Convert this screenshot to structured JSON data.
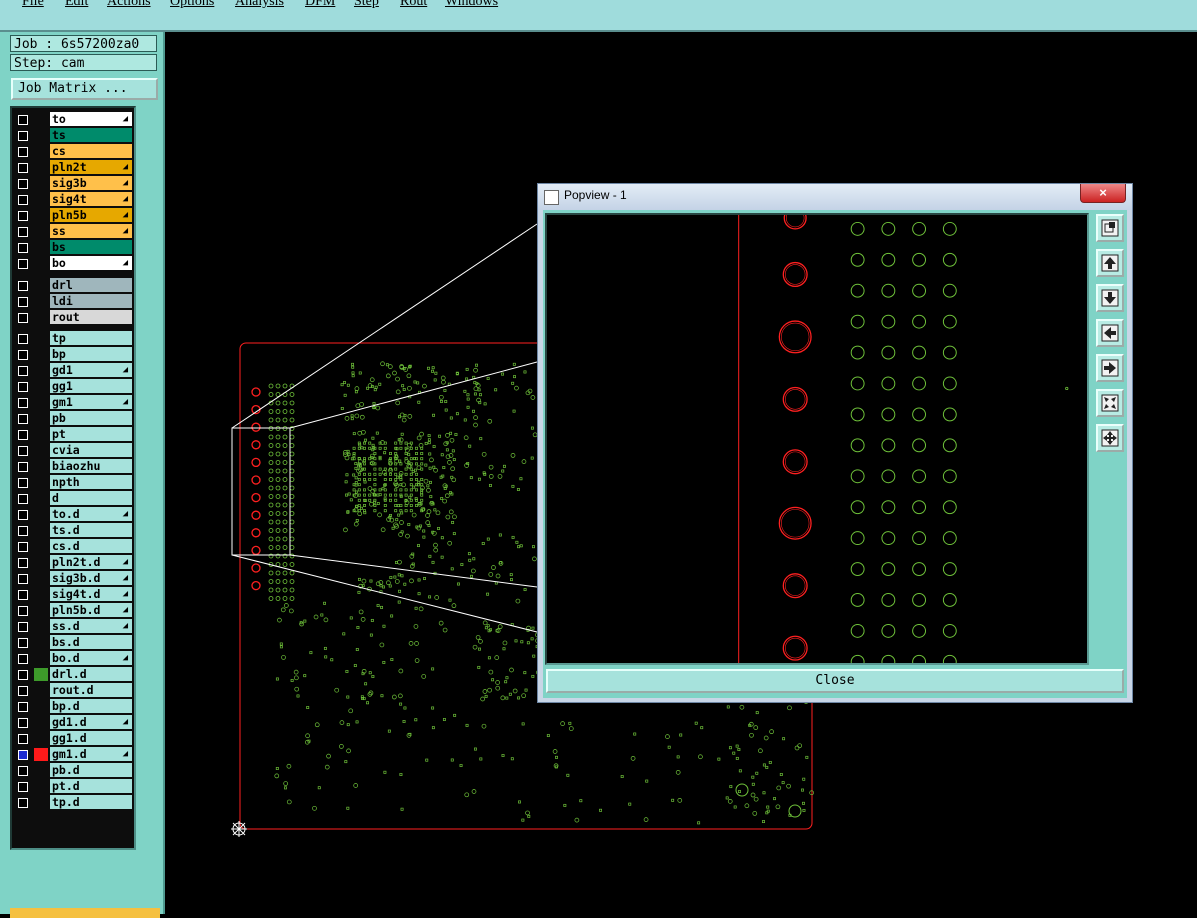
{
  "menu": [
    "File",
    "Edit",
    "Actions",
    "Options",
    "Analysis",
    "DFM",
    "Step",
    "Rout",
    "Windows"
  ],
  "job_label": "Job : 6s57200za0",
  "step_label": "Step: cam",
  "job_matrix_label": "Job Matrix ...",
  "colors": {
    "panel": "#7fd3c6",
    "canvas": "#000000",
    "board_outline": "#ff2020",
    "feature_green": "#6fc23a",
    "pad_red": "#ff2020"
  },
  "layer_groups": [
    {
      "name": "board",
      "layers": [
        {
          "label": "to",
          "bg": "#ffffff",
          "flag": true
        },
        {
          "label": "ts",
          "bg": "#008b6b",
          "flag": false
        },
        {
          "label": "cs",
          "bg": "#ffc04a",
          "flag": false
        },
        {
          "label": "pln2t",
          "bg": "#e6a800",
          "flag": true
        },
        {
          "label": "sig3b",
          "bg": "#ffc04a",
          "flag": true
        },
        {
          "label": "sig4t",
          "bg": "#ffc04a",
          "flag": true
        },
        {
          "label": "pln5b",
          "bg": "#e6a800",
          "flag": true
        },
        {
          "label": "ss",
          "bg": "#ffc04a",
          "flag": true
        },
        {
          "label": "bs",
          "bg": "#008b6b",
          "flag": false
        },
        {
          "label": "bo",
          "bg": "#ffffff",
          "flag": true
        }
      ]
    },
    {
      "name": "drill",
      "layers": [
        {
          "label": "drl",
          "bg": "#9fb6bc",
          "flag": false
        },
        {
          "label": "ldi",
          "bg": "#9fb6bc",
          "flag": false
        },
        {
          "label": "rout",
          "bg": "#d8d8d8",
          "flag": false
        }
      ]
    },
    {
      "name": "misc",
      "layers": [
        {
          "label": "tp",
          "bg": "#a6e2dc",
          "flag": false
        },
        {
          "label": "bp",
          "bg": "#a6e2dc",
          "flag": false
        },
        {
          "label": "gd1",
          "bg": "#a6e2dc",
          "flag": true
        },
        {
          "label": "gg1",
          "bg": "#a6e2dc",
          "flag": false
        },
        {
          "label": "gm1",
          "bg": "#a6e2dc",
          "flag": true
        },
        {
          "label": "pb",
          "bg": "#a6e2dc",
          "flag": false
        },
        {
          "label": "pt",
          "bg": "#a6e2dc",
          "flag": false
        },
        {
          "label": "cvia",
          "bg": "#a6e2dc",
          "flag": false
        },
        {
          "label": "biaozhu",
          "bg": "#a6e2dc",
          "flag": false
        },
        {
          "label": "npth",
          "bg": "#a6e2dc",
          "flag": false
        },
        {
          "label": "d",
          "bg": "#a6e2dc",
          "flag": false
        },
        {
          "label": "to.d",
          "bg": "#a6e2dc",
          "flag": true
        },
        {
          "label": "ts.d",
          "bg": "#a6e2dc",
          "flag": false
        },
        {
          "label": "cs.d",
          "bg": "#a6e2dc",
          "flag": false
        },
        {
          "label": "pln2t.d",
          "bg": "#a6e2dc",
          "flag": true
        },
        {
          "label": "sig3b.d",
          "bg": "#a6e2dc",
          "flag": true
        },
        {
          "label": "sig4t.d",
          "bg": "#a6e2dc",
          "flag": true
        },
        {
          "label": "pln5b.d",
          "bg": "#a6e2dc",
          "flag": true
        },
        {
          "label": "ss.d",
          "bg": "#a6e2dc",
          "flag": true
        },
        {
          "label": "bs.d",
          "bg": "#a6e2dc",
          "flag": false
        },
        {
          "label": "bo.d",
          "bg": "#a6e2dc",
          "flag": true
        },
        {
          "label": "drl.d",
          "bg": "#a6e2dc",
          "flag": false,
          "swatch": "#3d9a2a"
        },
        {
          "label": "rout.d",
          "bg": "#a6e2dc",
          "flag": false
        },
        {
          "label": "bp.d",
          "bg": "#a6e2dc",
          "flag": false
        },
        {
          "label": "gd1.d",
          "bg": "#a6e2dc",
          "flag": true
        },
        {
          "label": "gg1.d",
          "bg": "#a6e2dc",
          "flag": false
        },
        {
          "label": "gm1.d",
          "bg": "#a6e2dc",
          "flag": true,
          "swatch": "#ff1a1a",
          "checked": true
        },
        {
          "label": "pb.d",
          "bg": "#a6e2dc",
          "flag": false
        },
        {
          "label": "pt.d",
          "bg": "#a6e2dc",
          "flag": false
        },
        {
          "label": "tp.d",
          "bg": "#a6e2dc",
          "flag": false
        }
      ]
    }
  ],
  "popview": {
    "title": "Popview - 1",
    "close_x": "×",
    "close_label": "Close",
    "tools": [
      "zoom-window-icon",
      "pan-up-icon",
      "pan-down-icon",
      "pan-left-icon",
      "pan-right-icon",
      "zoom-fit-icon",
      "zoom-home-icon"
    ]
  }
}
